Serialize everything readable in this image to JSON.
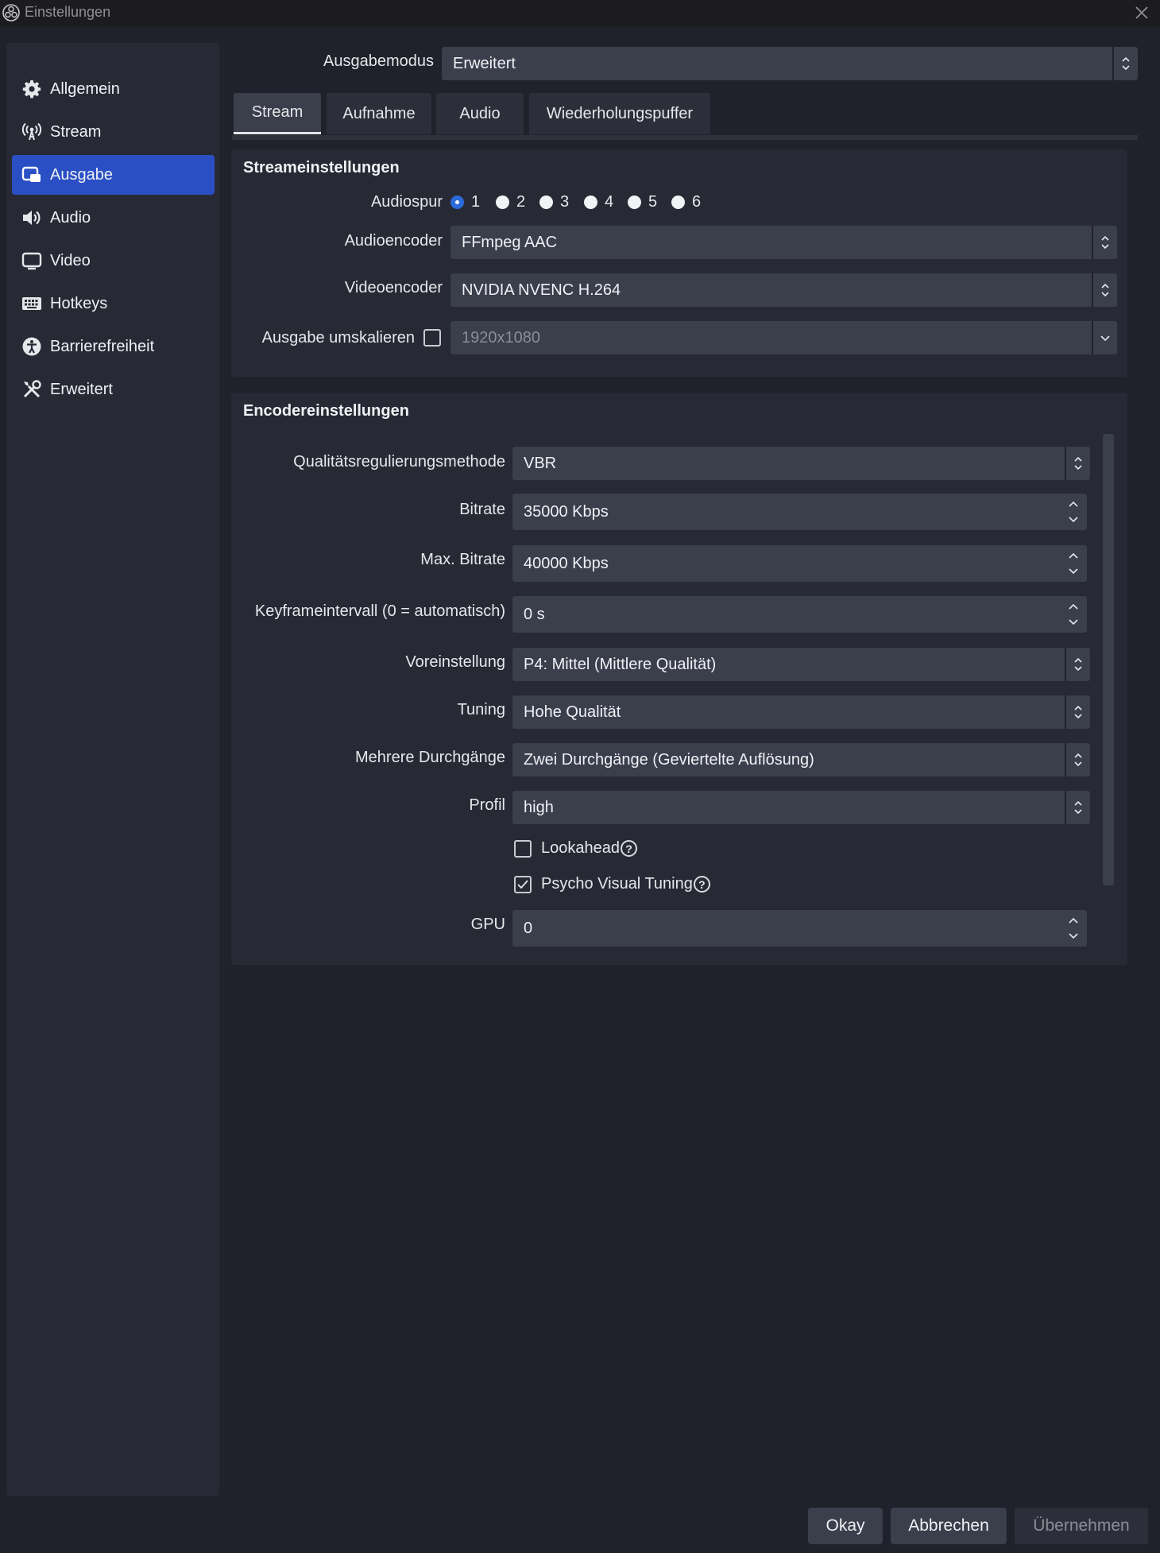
{
  "window": {
    "title": "Einstellungen",
    "logo_icon": "obs-logo-icon",
    "close_icon": "close-icon"
  },
  "sidebar": {
    "items": [
      {
        "label": "Allgemein",
        "icon": "gear-icon",
        "active": false
      },
      {
        "label": "Stream",
        "icon": "antenna-icon",
        "active": false
      },
      {
        "label": "Ausgabe",
        "icon": "output-icon",
        "active": true
      },
      {
        "label": "Audio",
        "icon": "speaker-icon",
        "active": false
      },
      {
        "label": "Video",
        "icon": "monitor-icon",
        "active": false
      },
      {
        "label": "Hotkeys",
        "icon": "keyboard-icon",
        "active": false
      },
      {
        "label": "Barrierefreiheit",
        "icon": "accessibility-icon",
        "active": false
      },
      {
        "label": "Erweitert",
        "icon": "tools-icon",
        "active": false
      }
    ]
  },
  "output_mode": {
    "label": "Ausgabemodus",
    "value": "Erweitert"
  },
  "tabs": [
    {
      "label": "Stream",
      "active": true
    },
    {
      "label": "Aufnahme",
      "active": false
    },
    {
      "label": "Audio",
      "active": false
    },
    {
      "label": "Wiederholungspuffer",
      "active": false
    }
  ],
  "stream_settings": {
    "title": "Streameinstellungen",
    "audio_track": {
      "label": "Audiospur",
      "options": [
        "1",
        "2",
        "3",
        "4",
        "5",
        "6"
      ],
      "selected": "1"
    },
    "audio_encoder": {
      "label": "Audioencoder",
      "value": "FFmpeg AAC"
    },
    "video_encoder": {
      "label": "Videoencoder",
      "value": "NVIDIA NVENC H.264"
    },
    "rescale": {
      "label": "Ausgabe umskalieren",
      "checked": false,
      "value": "1920x1080"
    }
  },
  "encoder_settings": {
    "title": "Encodereinstellungen",
    "rate_control": {
      "label": "Qualitätsregulierungsmethode",
      "value": "VBR"
    },
    "bitrate": {
      "label": "Bitrate",
      "value": "35000 Kbps"
    },
    "max_bitrate": {
      "label": "Max. Bitrate",
      "value": "40000 Kbps"
    },
    "keyframe": {
      "label": "Keyframeintervall (0 = automatisch)",
      "value": "0 s"
    },
    "preset": {
      "label": "Voreinstellung",
      "value": "P4: Mittel (Mittlere Qualität)"
    },
    "tuning": {
      "label": "Tuning",
      "value": "Hohe Qualität"
    },
    "multipass": {
      "label": "Mehrere Durchgänge",
      "value": "Zwei Durchgänge (Geviertelte Auflösung)"
    },
    "profile": {
      "label": "Profil",
      "value": "high"
    },
    "lookahead": {
      "label": "Lookahead",
      "checked": false
    },
    "psycho_visual": {
      "label": "Psycho Visual Tuning",
      "checked": true
    },
    "gpu": {
      "label": "GPU",
      "value": "0"
    }
  },
  "buttons": {
    "ok": "Okay",
    "cancel": "Abbrechen",
    "apply": "Übernehmen"
  },
  "colors": {
    "accent": "#2a4fc4",
    "background": "#1f212b",
    "panel": "#272a35",
    "control": "#3b3e4b"
  }
}
